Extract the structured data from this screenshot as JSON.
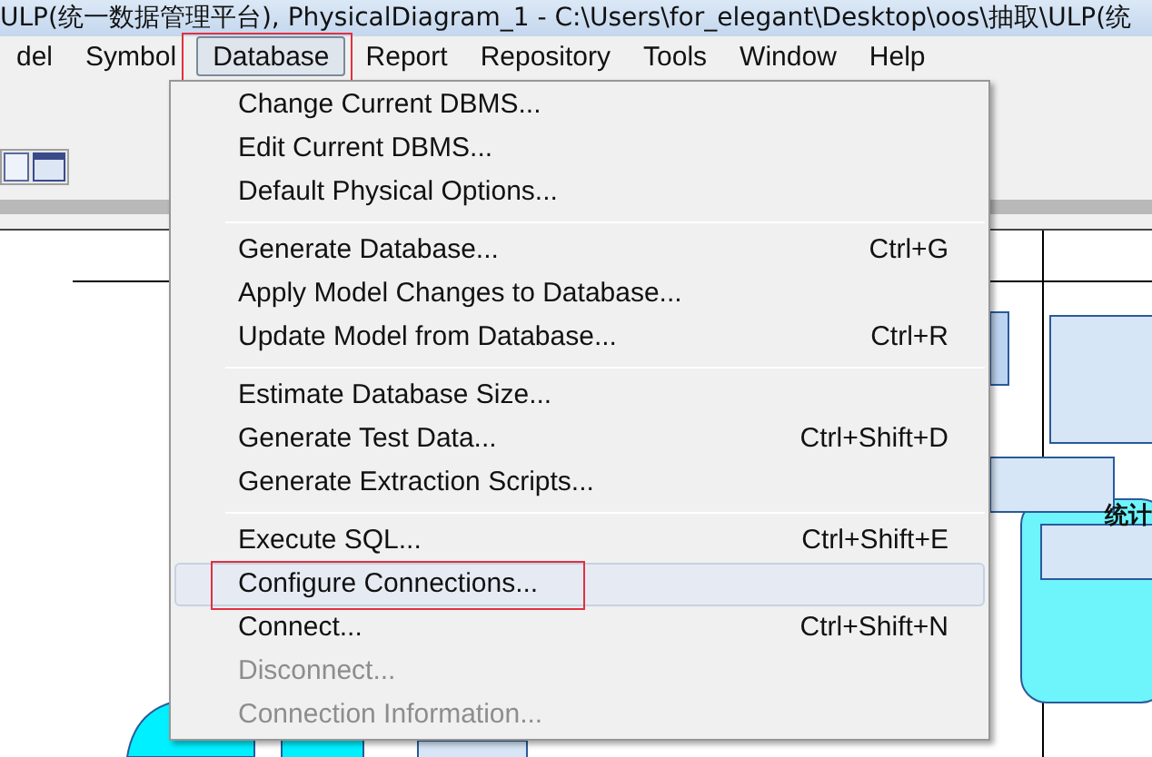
{
  "window": {
    "title": "ULP(统一数据管理平台), PhysicalDiagram_1 - C:\\Users\\for_elegant\\Desktop\\oos\\抽取\\ULP(统"
  },
  "menu_bar": [
    {
      "label": "del",
      "selected": false,
      "annotated": false
    },
    {
      "label": "Symbol",
      "selected": false,
      "annotated": false
    },
    {
      "label": "Database",
      "selected": true,
      "annotated": true
    },
    {
      "label": "Report",
      "selected": false,
      "annotated": false
    },
    {
      "label": "Repository",
      "selected": false,
      "annotated": false
    },
    {
      "label": "Tools",
      "selected": false,
      "annotated": false
    },
    {
      "label": "Window",
      "selected": false,
      "annotated": false
    },
    {
      "label": "Help",
      "selected": false,
      "annotated": false
    }
  ],
  "menu": {
    "groups": [
      {
        "items": [
          {
            "label": "Change Current DBMS...",
            "disabled": false,
            "selected": false,
            "annotated": false
          },
          {
            "label": "Edit Current DBMS...",
            "disabled": false,
            "selected": false,
            "annotated": false
          },
          {
            "label": "Default Physical Options...",
            "disabled": false,
            "selected": false,
            "annotated": false
          }
        ]
      },
      {
        "items": [
          {
            "label": "Generate Database...",
            "shortcut": "Ctrl+G",
            "disabled": false,
            "selected": false,
            "annotated": false
          },
          {
            "label": "Apply Model Changes to Database...",
            "disabled": false,
            "selected": false,
            "annotated": false
          },
          {
            "label": "Update Model from Database...",
            "shortcut": "Ctrl+R",
            "disabled": false,
            "selected": false,
            "annotated": false
          }
        ]
      },
      {
        "items": [
          {
            "label": "Estimate Database Size...",
            "disabled": false,
            "selected": false,
            "annotated": false
          },
          {
            "label": "Generate Test Data...",
            "shortcut": "Ctrl+Shift+D",
            "disabled": false,
            "selected": false,
            "annotated": false
          },
          {
            "label": "Generate Extraction Scripts...",
            "disabled": false,
            "selected": false,
            "annotated": false
          }
        ]
      },
      {
        "items": [
          {
            "label": "Execute SQL...",
            "shortcut": "Ctrl+Shift+E",
            "disabled": false,
            "selected": false,
            "annotated": false
          },
          {
            "label": "Configure Connections...",
            "disabled": false,
            "selected": true,
            "annotated": true
          },
          {
            "label": "Connect...",
            "shortcut": "Ctrl+Shift+N",
            "disabled": false,
            "selected": false,
            "annotated": false
          },
          {
            "label": "Disconnect...",
            "disabled": true,
            "selected": false,
            "annotated": false
          },
          {
            "label": "Connection Information...",
            "disabled": true,
            "selected": false,
            "annotated": false
          }
        ]
      }
    ]
  },
  "diagram": {
    "package_label": "统计"
  }
}
